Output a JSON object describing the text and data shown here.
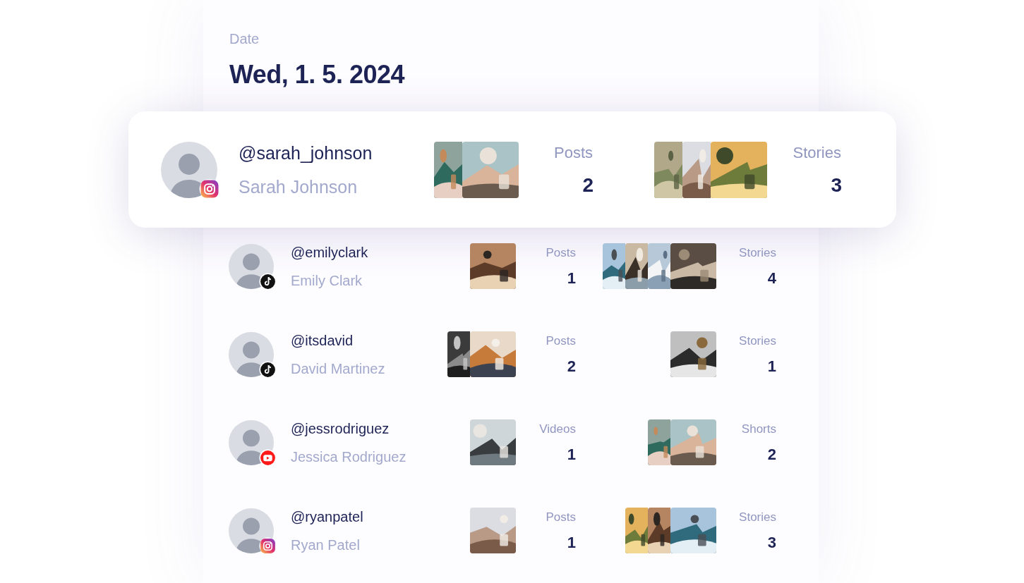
{
  "header": {
    "label": "Date",
    "date": "Wed, 1. 5. 2024"
  },
  "accounts": [
    {
      "handle": "@sarah_johnson",
      "name": "Sarah Johnson",
      "badge": {
        "kind": "instagram"
      },
      "highlighted": true,
      "primary": {
        "label": "Posts",
        "count": "2"
      },
      "secondary": {
        "label": "Stories",
        "count": "3"
      }
    },
    {
      "handle": "@emilyclark",
      "name": "Emily Clark",
      "badge": {
        "kind": "tiktok"
      },
      "highlighted": false,
      "primary": {
        "label": "Posts",
        "count": "1"
      },
      "secondary": {
        "label": "Stories",
        "count": "4"
      }
    },
    {
      "handle": "@itsdavid",
      "name": "David Martinez",
      "badge": {
        "kind": "tiktok"
      },
      "highlighted": false,
      "primary": {
        "label": "Posts",
        "count": "2"
      },
      "secondary": {
        "label": "Stories",
        "count": "1"
      }
    },
    {
      "handle": "@jessrodriguez",
      "name": "Jessica Rodriguez",
      "badge": {
        "kind": "youtube"
      },
      "highlighted": false,
      "primary": {
        "label": "Videos",
        "count": "1"
      },
      "secondary": {
        "label": "Shorts",
        "count": "2"
      }
    },
    {
      "handle": "@ryanpatel",
      "name": "Ryan Patel",
      "badge": {
        "kind": "instagram"
      },
      "highlighted": false,
      "primary": {
        "label": "Posts",
        "count": "1"
      },
      "secondary": {
        "label": "Stories",
        "count": "3"
      }
    }
  ]
}
